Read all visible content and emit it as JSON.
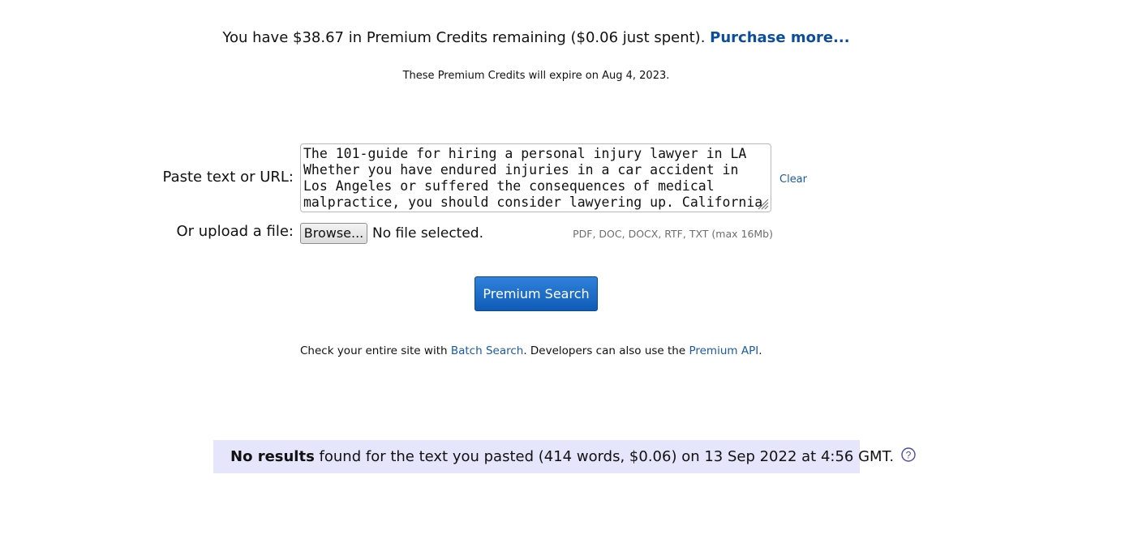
{
  "credits": {
    "text": "You have $38.67 in Premium Credits remaining ($0.06 just spent).",
    "purchase_link": "Purchase more...",
    "expire_text": "These Premium Credits will expire on Aug 4, 2023."
  },
  "form": {
    "paste_label": "Paste text or URL:",
    "paste_value": "The 101-guide for hiring a personal injury lawyer in LA\nWhether you have endured injuries in a car accident in Los Angeles or suffered the consequences of medical malpractice, you should consider lawyering up. California",
    "clear_label": "Clear",
    "upload_label": "Or upload a file:",
    "browse_label": "Browse...",
    "file_status": "No file selected.",
    "file_types": "PDF, DOC, DOCX, RTF, TXT (max 16Mb)",
    "search_button": "Premium Search"
  },
  "batch": {
    "prefix": "Check your entire site with",
    "batch_link": "Batch Search",
    "middle": ". Developers can also use the",
    "api_link": "Premium API",
    "suffix": "."
  },
  "results": {
    "bold": "No results",
    "text": "found for the text you pasted (414 words, $0.06) on 13 Sep 2022 at 4:56 GMT.",
    "help_icon": "question-circle-icon",
    "background_color": "#e5e5fb"
  },
  "colors": {
    "link": "#1a5aa6",
    "purchase_link": "#0b4f9c",
    "button": "#1a6bc8"
  }
}
